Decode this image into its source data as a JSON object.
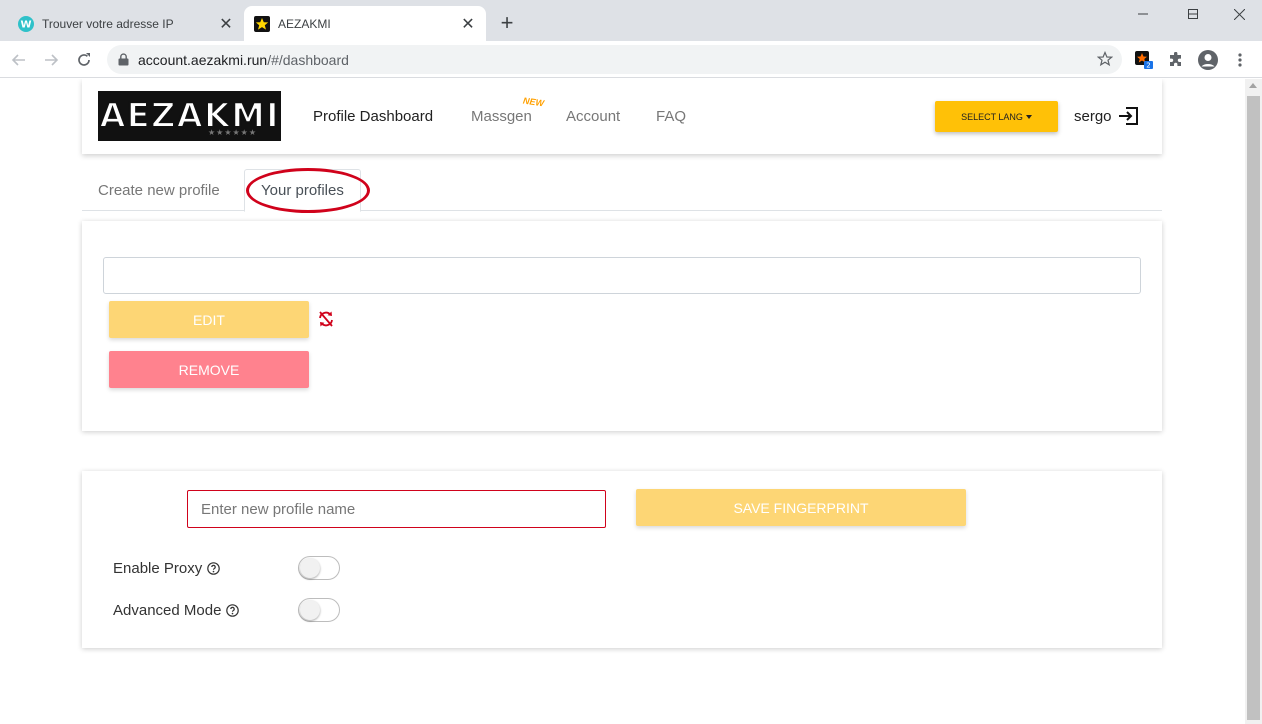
{
  "browser": {
    "tabs": [
      {
        "title": "Trouver votre adresse IP",
        "favicon": "w-logo-icon",
        "active": false
      },
      {
        "title": "AEZAKMI",
        "favicon": "star-favicon-icon",
        "active": true
      }
    ],
    "url_host": "account.aezakmi.run",
    "url_path": "/#/dashboard",
    "extension_badge": "2"
  },
  "site": {
    "logo_text": "AEZAKMI",
    "logo_stars": "★★★★★★",
    "nav": {
      "profile_dashboard": "Profile Dashboard",
      "massgen": "Massgen",
      "new_badge": "NEW",
      "account": "Account",
      "faq": "FAQ"
    },
    "lang_button": "SELECT LANG",
    "username": "sergo"
  },
  "profile_tabs": {
    "create": "Create new profile",
    "yours": "Your profiles"
  },
  "profiles_card": {
    "selected_profile": "",
    "edit_label": "EDIT",
    "remove_label": "REMOVE"
  },
  "new_profile_card": {
    "name_placeholder": "Enter new profile name",
    "save_label": "SAVE FINGERPRINT",
    "proxy_label": "Enable Proxy",
    "advanced_label": "Advanced Mode",
    "proxy_enabled": false,
    "advanced_enabled": false
  },
  "colors": {
    "accent": "#ffc107",
    "edit_button": "#fdd675",
    "remove_button": "#ff828e",
    "highlight_circle": "#d0021b"
  }
}
